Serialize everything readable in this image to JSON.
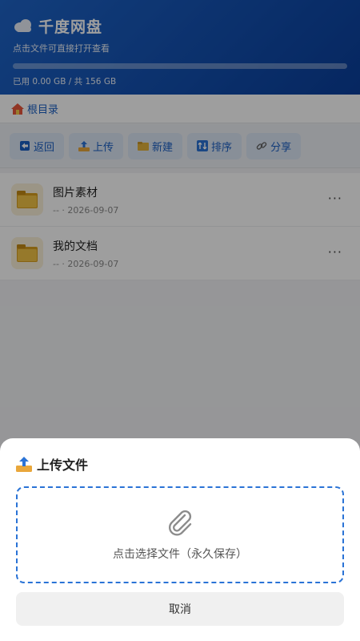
{
  "header": {
    "title": "千度网盘",
    "subtitle": "点击文件可直接打开查看",
    "storage_text": "已用 0.00 GB / 共 156 GB",
    "storage_used_fraction": 0.0,
    "icon": "cloud-icon"
  },
  "breadcrumb": {
    "label": "根目录",
    "icon": "home-icon"
  },
  "toolbar": {
    "buttons": [
      {
        "label": "返回",
        "icon": "back-arrow-icon"
      },
      {
        "label": "上传",
        "icon": "upload-icon"
      },
      {
        "label": "新建",
        "icon": "folder-icon"
      },
      {
        "label": "排序",
        "icon": "sort-icon"
      },
      {
        "label": "分享",
        "icon": "link-icon"
      }
    ]
  },
  "files": [
    {
      "name": "图片素材",
      "meta": "-- · 2026-09-07",
      "icon": "folder-icon",
      "more": "···"
    },
    {
      "name": "我的文档",
      "meta": "-- · 2026-09-07",
      "icon": "folder-icon",
      "more": "···"
    }
  ],
  "upload_sheet": {
    "title": "上传文件",
    "drop_text": "点击选择文件（永久保存）",
    "cancel_label": "取消",
    "icons": {
      "title": "upload-icon",
      "drop": "paperclip-icon"
    }
  },
  "colors": {
    "brand": "#1a5fc4",
    "header_start": "#1e64c8",
    "header_end": "#0a3f9c",
    "dash_border": "#2a73d6"
  }
}
